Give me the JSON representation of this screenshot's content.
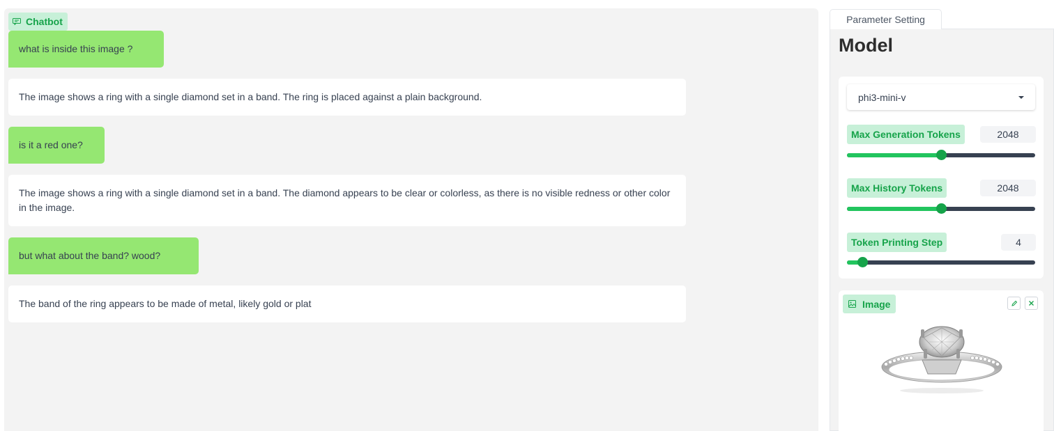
{
  "chatbot": {
    "label": "Chatbot",
    "icon": "chat-icon",
    "messages": [
      {
        "role": "user",
        "text": "what is inside this image ?"
      },
      {
        "role": "bot",
        "text": "The image shows a ring with a single diamond set in a band. The ring is placed against a plain background."
      },
      {
        "role": "user",
        "text": "is it a red one?"
      },
      {
        "role": "bot",
        "text": "The image shows a ring with a single diamond set in a band. The diamond appears to be clear or colorless, as there is no visible redness or other color in the image."
      },
      {
        "role": "user",
        "text": "but what about the band? wood?"
      },
      {
        "role": "bot",
        "text": "The band of the ring appears to be made of metal, likely gold or plat"
      }
    ]
  },
  "settings": {
    "tab_label": "Parameter Setting",
    "heading": "Model",
    "model_select": {
      "value": "phi3-mini-v"
    },
    "sliders": [
      {
        "label": "Max Generation Tokens",
        "value": "2048",
        "fraction": 0.5
      },
      {
        "label": "Max History Tokens",
        "value": "2048",
        "fraction": 0.5
      },
      {
        "label": "Token Printing Step",
        "value": "4",
        "fraction": 0.08
      }
    ],
    "image": {
      "label": "Image",
      "icon": "image-icon",
      "edit_icon": "pencil-icon",
      "close_icon": "close-icon"
    }
  },
  "colors": {
    "accent": "#16a34a",
    "user_bubble": "#95e772",
    "label_bg": "#c7f0d8"
  }
}
